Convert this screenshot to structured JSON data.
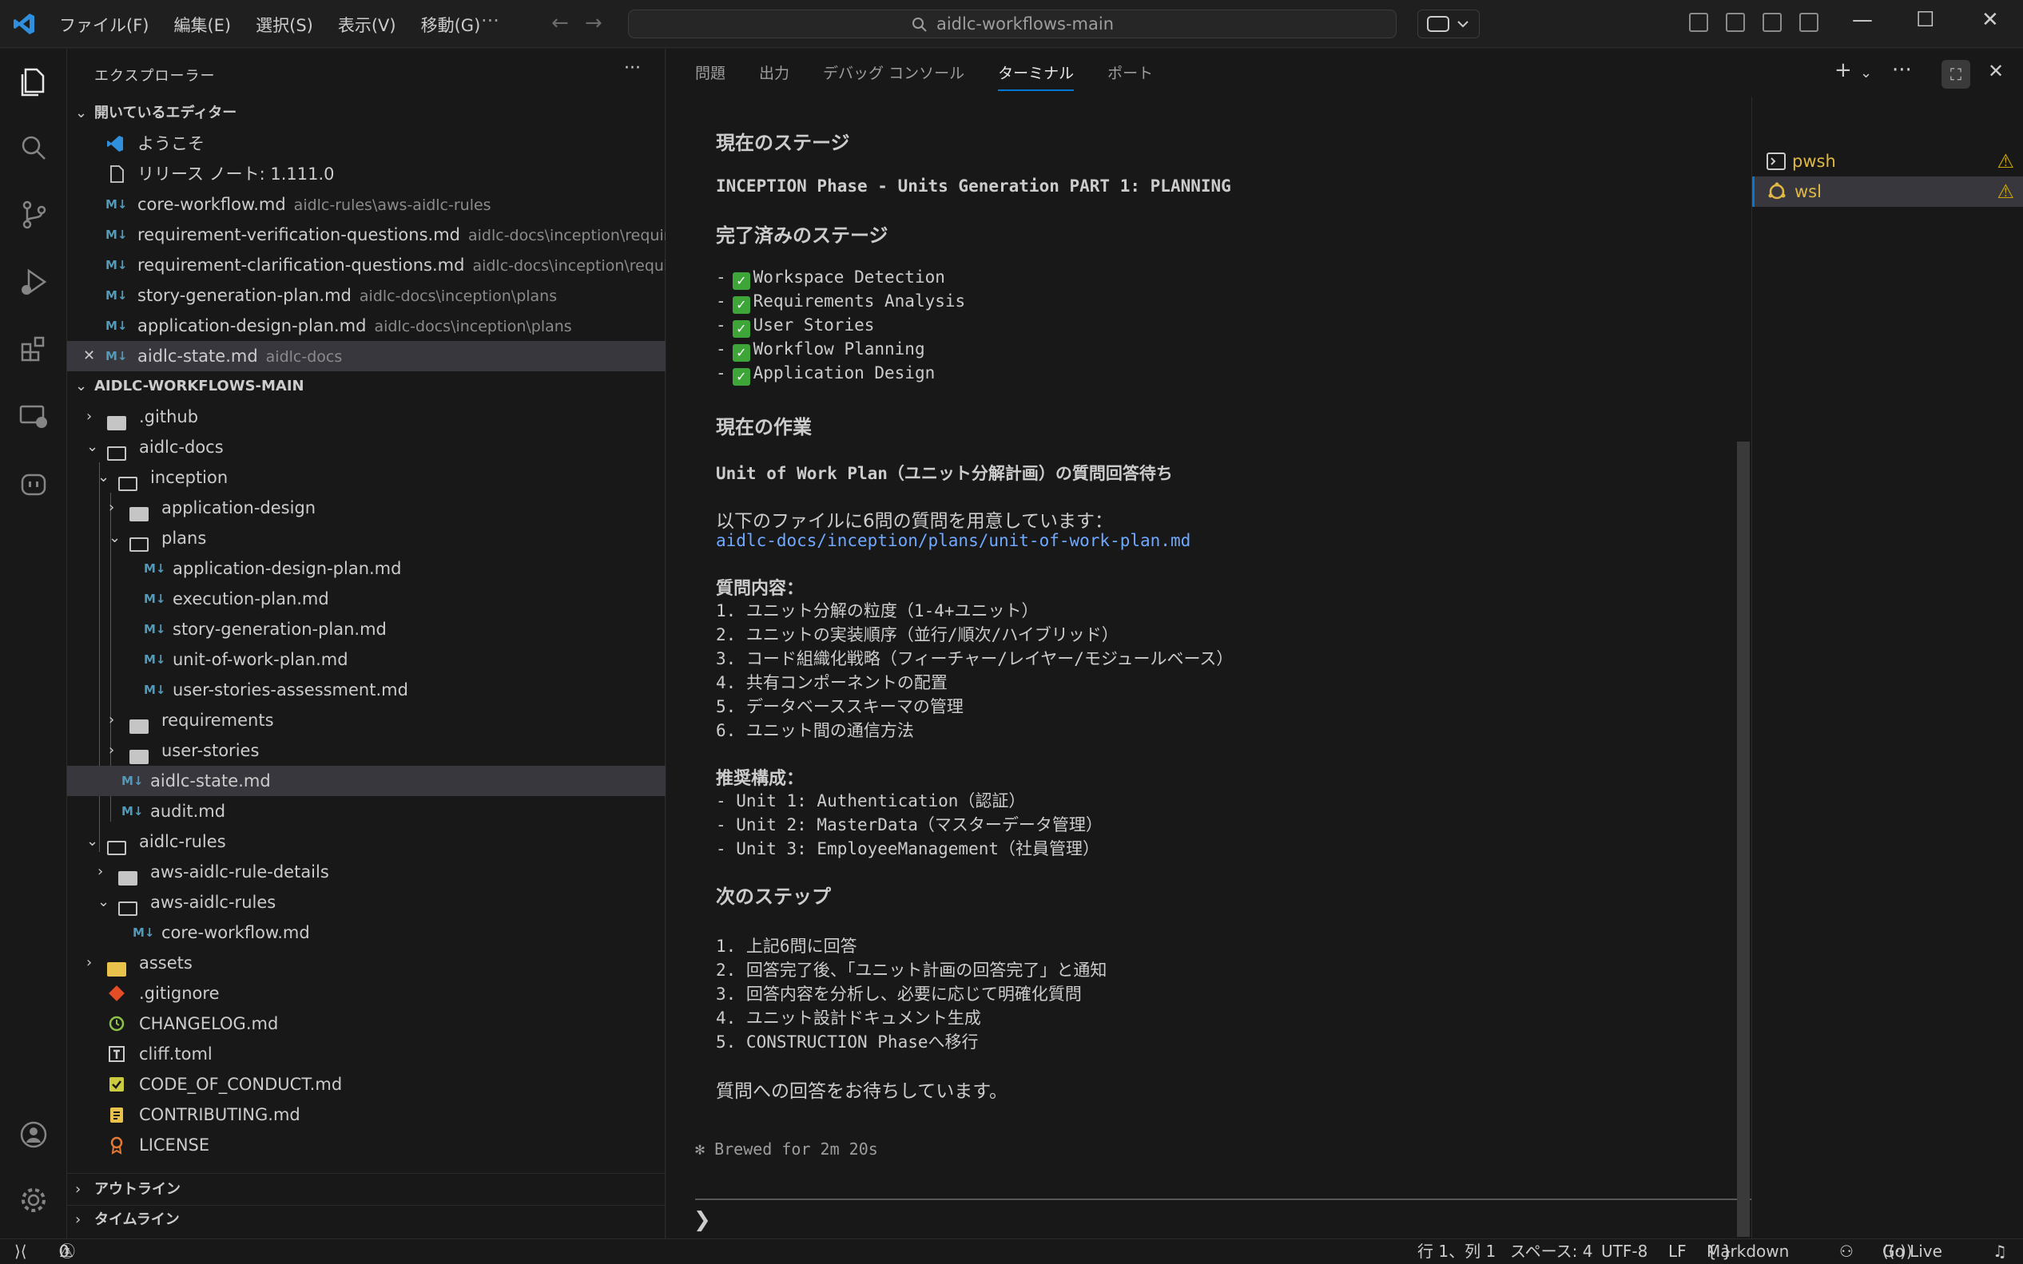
{
  "menu": [
    "ファイル(F)",
    "編集(E)",
    "選択(S)",
    "表示(V)",
    "移動(G)"
  ],
  "search": {
    "text": "aidlc-workflows-main"
  },
  "sidebar": {
    "title": "エクスプローラー",
    "open_editors_title": "開いているエディター",
    "open_editors": [
      {
        "name": "ようこそ",
        "path": ""
      },
      {
        "name": "リリース ノート: 1.111.0",
        "path": ""
      },
      {
        "name": "core-workflow.md",
        "path": "aidlc-rules\\aws-aidlc-rules"
      },
      {
        "name": "requirement-verification-questions.md",
        "path": "aidlc-docs\\inception\\requir..."
      },
      {
        "name": "requirement-clarification-questions.md",
        "path": "aidlc-docs\\inception\\requi..."
      },
      {
        "name": "story-generation-plan.md",
        "path": "aidlc-docs\\inception\\plans"
      },
      {
        "name": "application-design-plan.md",
        "path": "aidlc-docs\\inception\\plans"
      },
      {
        "name": "aidlc-state.md",
        "path": "aidlc-docs"
      }
    ],
    "workspace_title": "AIDLC-WORKFLOWS-MAIN",
    "tree": [
      ".github",
      "aidlc-docs",
      "inception",
      "application-design",
      "plans",
      "application-design-plan.md",
      "execution-plan.md",
      "story-generation-plan.md",
      "unit-of-work-plan.md",
      "user-stories-assessment.md",
      "requirements",
      "user-stories",
      "aidlc-state.md",
      "audit.md",
      "aidlc-rules",
      "aws-aidlc-rule-details",
      "aws-aidlc-rules",
      "core-workflow.md",
      "assets",
      ".gitignore",
      "CHANGELOG.md",
      "cliff.toml",
      "CODE_OF_CONDUCT.md",
      "CONTRIBUTING.md",
      "LICENSE"
    ],
    "outline": "アウトライン",
    "timeline": "タイムライン",
    "md_badge": "M↓"
  },
  "panel": {
    "tabs": [
      "問題",
      "出力",
      "デバッグ コンソール",
      "ターミナル",
      "ポート"
    ],
    "active_tab": "ターミナル",
    "terminals": [
      {
        "name": "pwsh"
      },
      {
        "name": "wsl"
      }
    ]
  },
  "terminal": {
    "h_current_stage": "現在のステージ",
    "current_stage": "INCEPTION Phase - Units Generation PART 1: PLANNING",
    "h_completed": "完了済みのステージ",
    "completed": [
      "Workspace Detection",
      "Requirements Analysis",
      "User Stories",
      "Workflow Planning",
      "Application Design"
    ],
    "h_current_work": "現在の作業",
    "current_work": "Unit of Work Plan（ユニット分解計画）の質問回答待ち",
    "intro": "以下のファイルに6問の質問を用意しています：",
    "file_link": "aidlc-docs/inception/plans/unit-of-work-plan.md",
    "h_questions": "質問内容：",
    "questions": [
      "1. ユニット分解の粒度（1-4+ユニット）",
      "2. ユニットの実装順序（並行/順次/ハイブリッド）",
      "3. コード組織化戦略（フィーチャー/レイヤー/モジュールベース）",
      "4. 共有コンポーネントの配置",
      "5. データベーススキーマの管理",
      "6. ユニット間の通信方法"
    ],
    "h_recommended": "推奨構成：",
    "recommended": [
      "- Unit 1: Authentication（認証）",
      "- Unit 2: MasterData（マスターデータ管理）",
      "- Unit 3: EmployeeManagement（社員管理）"
    ],
    "h_next": "次のステップ",
    "next": [
      "1. 上記6問に回答",
      "2. 回答完了後、「ユニット計画の回答完了」と通知",
      "3. 回答内容を分析し、必要に応じて明確化質問",
      "4. ユニット設計ドキュメント生成",
      "5. CONSTRUCTION Phaseへ移行"
    ],
    "waiting": "質問への回答をお待ちしています。",
    "brewed": "✻ Brewed for 2m 20s",
    "prompt": "❯"
  },
  "status": {
    "errors": "0",
    "warnings": "0",
    "position": "行 1、列 1",
    "spaces": "スペース: 4",
    "encoding": "UTF-8",
    "eol": "LF",
    "language": "Markdown",
    "golive": "Go Live"
  }
}
